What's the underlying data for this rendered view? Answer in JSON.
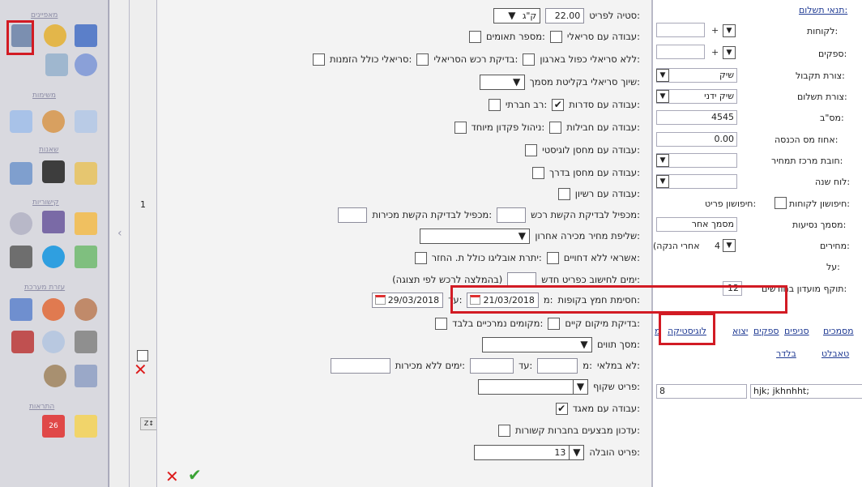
{
  "sidebar": {
    "sections": [
      {
        "key": "settings",
        "label": "מאפיינים"
      },
      {
        "key": "tasks",
        "label": "משימות"
      },
      {
        "key": "reports",
        "label": "שאנות"
      },
      {
        "key": "links",
        "label": "קישוריות"
      },
      {
        "key": "system",
        "label": "עזרת מערכת"
      },
      {
        "key": "alerts",
        "label": "התראות"
      }
    ],
    "calendar_day": "26"
  },
  "background": {
    "row_value": "1"
  },
  "right_panel": {
    "title": "תנאי תשלום:",
    "customers": "לקוחות:",
    "suppliers": "ספקים:",
    "receipt_form_label": "צורת תקבול:",
    "receipt_form_value": "שיק",
    "payment_form_label": "צורת תשלום:",
    "payment_form_value": "שיק ידני",
    "vat_label": "מס\"ב:",
    "vat_value": "4545",
    "income_tax_label": "אחוז מס הכנסה:",
    "income_tax_value": "0.00",
    "price_center_label": "חובת מרכז תמחיר:",
    "year_board_label": "לוח שנה:",
    "search_customers_label": "חיפושון לקוחות:",
    "search_items_label": "חיפושון פריט:",
    "ship_doc_label": "מסמך נסיעות:",
    "ship_doc_value": "מסמך אחר",
    "prices_label": "מחירים:",
    "prices_value": "4",
    "prices_note": "(אחרי הנקה",
    "on_label": "על:",
    "club_validity_label": "תוקף מועדון בחודשים:",
    "club_validity_value": "12",
    "tabs": [
      "מסמכים",
      "סניפים",
      "ספקים",
      "יצוא",
      "לוגיסטיקה",
      "מ"
    ],
    "tabs_row2": [
      "טאבלט",
      "בלדר"
    ],
    "footer_text": "hjk; jkhnhht;",
    "footer_num": "8"
  },
  "dialog": {
    "pallet_height_label": "סטיה לפריט:",
    "pallet_height_value": "22.00",
    "pallet_unit": "ק\"ג",
    "serial_work_label": "עבודה עם סריאלי:",
    "serial_twin_label": "מספר תאומים:",
    "no_serial_label": "ללא סריאלי כפול בארגון:",
    "serial_check_label": "בדיקת רכש הסריאלי:",
    "serial_include_orders_label": "סריאלי כולל הזמנות:",
    "serial_assign_label": "שיוך סריאלי בקליטת מסמך:",
    "series_work_label": "עבודה עם סדרות:",
    "multi_company_label": "רב חברתי:",
    "packages_work_label": "עבודה עם חבילות:",
    "special_deposit_label": "ניהול פקדון מיוחד:",
    "logistic_wh_label": "עבודה עם מחסן לוגיסטי:",
    "transit_wh_label": "עבודה עם מחסן בדרך:",
    "license_work_label": "עבודה עם רשיון:",
    "purchase_mult_label": "מכפיל לבדיקת הקשת רכש:",
    "sales_mult_label": "מכפיל לבדיקת הקשת מכירות:",
    "last_sale_price_label": "שליפת מחיר מכירה אחרון:",
    "credit_no_reports_label": "אשראי ללא דחויים:",
    "obligo_balance_label": "יתרת אובליגו כולל ת. החזר:",
    "new_item_days_label": "ימים לחישוב כפריט חדש:",
    "new_item_days_note": "(בהמלצה לרכש לפי תצוגה)",
    "cash_block_label": "חסימת חמץ בקופות:",
    "cash_block_from_label": "מ:",
    "cash_block_from_value": "21/03/2018",
    "cash_block_to_label": "עד:",
    "cash_block_to_value": "29/03/2018",
    "location_check_label": "בדיקת מיקום קיים:",
    "marked_locations_label": "מקומים נמרכיים בלבד:",
    "twin_screen_label": "מסך תווים:",
    "not_full_label": "לא במלאי:",
    "not_full_from_label": "מ:",
    "not_full_to_label": "עד:",
    "no_sale_days_label": "ימים ללא מכירות:",
    "transparent_item_label": "פריט שקוף:",
    "warehouse_work_label": "עבודה עם מאגד:",
    "related_ops_label": "עדכון מבצעים בחברות קשורות:",
    "transport_item_label": "פריט הובלה:",
    "transport_item_value": "13"
  }
}
